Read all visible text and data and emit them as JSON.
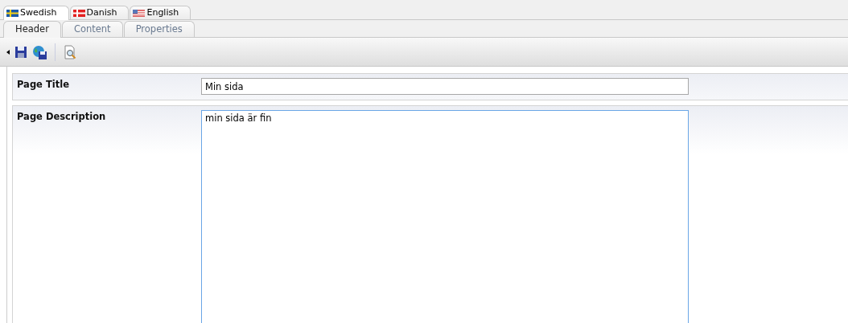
{
  "language_tabs": [
    {
      "label": "Swedish",
      "kind": "sweden",
      "selected": true
    },
    {
      "label": "Danish",
      "kind": "denmark",
      "selected": false
    },
    {
      "label": "English",
      "kind": "usa",
      "selected": false
    }
  ],
  "section_tabs": [
    {
      "label": "Header",
      "selected": true
    },
    {
      "label": "Content",
      "selected": false
    },
    {
      "label": "Properties",
      "selected": false
    }
  ],
  "fields": [
    {
      "label": "Page Title",
      "kind": "text",
      "value": "Min sida",
      "focused": false
    },
    {
      "label": "Page Description",
      "kind": "textarea",
      "value": "min sida är fin",
      "focused": true
    }
  ]
}
